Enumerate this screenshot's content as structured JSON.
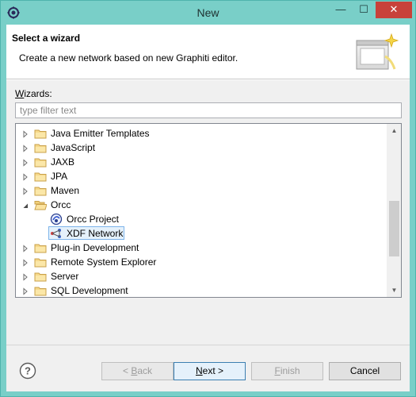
{
  "window": {
    "title": "New",
    "minimize_glyph": "—",
    "maximize_glyph": "☐",
    "close_glyph": "✕"
  },
  "banner": {
    "title": "Select a wizard",
    "description": "Create a new network based on new Graphiti editor."
  },
  "wizards": {
    "label_prefix": "W",
    "label_rest": "izards:",
    "filter_placeholder": "type filter text",
    "filter_value": ""
  },
  "tree": {
    "items": [
      {
        "label": "Java Emitter Templates",
        "level": 0,
        "expanded": false,
        "icon": "folder-icon"
      },
      {
        "label": "JavaScript",
        "level": 0,
        "expanded": false,
        "icon": "folder-icon"
      },
      {
        "label": "JAXB",
        "level": 0,
        "expanded": false,
        "icon": "folder-icon"
      },
      {
        "label": "JPA",
        "level": 0,
        "expanded": false,
        "icon": "folder-icon"
      },
      {
        "label": "Maven",
        "level": 0,
        "expanded": false,
        "icon": "folder-icon"
      },
      {
        "label": "Orcc",
        "level": 0,
        "expanded": true,
        "icon": "folder-open-icon"
      },
      {
        "label": "Orcc Project",
        "level": 1,
        "icon": "orcc-project-icon"
      },
      {
        "label": "XDF Network",
        "level": 1,
        "icon": "xdf-network-icon",
        "selected": true
      },
      {
        "label": "Plug-in Development",
        "level": 0,
        "expanded": false,
        "icon": "folder-icon"
      },
      {
        "label": "Remote System Explorer",
        "level": 0,
        "expanded": false,
        "icon": "folder-icon"
      },
      {
        "label": "Server",
        "level": 0,
        "expanded": false,
        "icon": "folder-icon"
      },
      {
        "label": "SQL Development",
        "level": 0,
        "expanded": false,
        "icon": "folder-icon"
      }
    ]
  },
  "buttons": {
    "back_prefix": "< ",
    "back_mnemonic": "B",
    "back_rest": "ack",
    "next_mnemonic": "N",
    "next_rest": "ext >",
    "finish_mnemonic": "F",
    "finish_rest": "inish",
    "cancel": "Cancel"
  },
  "colors": {
    "title_bar": "#79cfc8",
    "close_button": "#c8413a",
    "selection_border": "#7eb4ea",
    "selection_fill": "#e5f1fb"
  }
}
